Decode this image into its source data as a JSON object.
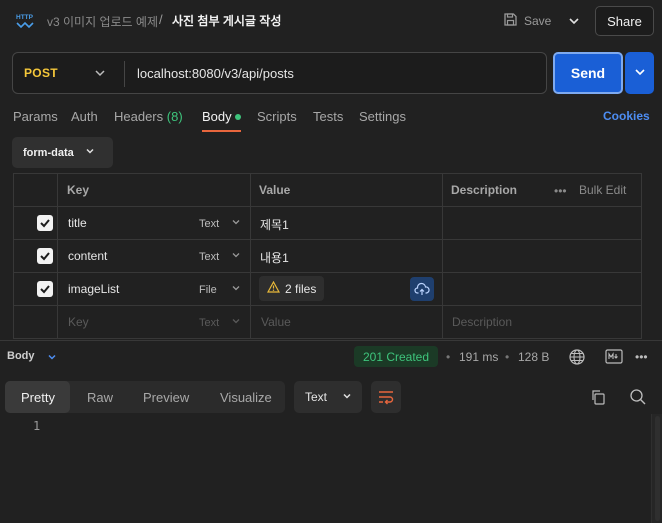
{
  "header": {
    "collection": "v3 이미지 업로드 예제",
    "separator": "/",
    "request_name": "사진 첨부 게시글 작성",
    "save_label": "Save",
    "share_label": "Share",
    "app_icon": "http-icon"
  },
  "request": {
    "method": "POST",
    "url": "localhost:8080/v3/api/posts",
    "send_label": "Send",
    "method_color": "#f5c73a",
    "send_color": "#1a5fd6"
  },
  "tabs": {
    "params": "Params",
    "auth": "Auth",
    "headers": "Headers",
    "headers_count": "(8)",
    "body": "Body",
    "scripts": "Scripts",
    "tests": "Tests",
    "settings": "Settings",
    "cookies": "Cookies",
    "active": "Body"
  },
  "body": {
    "mode": "form-data",
    "columns": {
      "key": "Key",
      "value": "Value",
      "description": "Description",
      "bulk_edit": "Bulk Edit"
    },
    "rows": [
      {
        "checked": true,
        "key": "title",
        "type": "Text",
        "value": "제목1",
        "description": ""
      },
      {
        "checked": true,
        "key": "content",
        "type": "Text",
        "value": "내용1",
        "description": ""
      },
      {
        "checked": true,
        "key": "imageList",
        "type": "File",
        "value": "2 files",
        "description": ""
      }
    ],
    "placeholder_row": {
      "key": "Key",
      "type": "Text",
      "value": "Value",
      "description": "Description"
    }
  },
  "response": {
    "label": "Body",
    "status": "201 Created",
    "time": "191 ms",
    "size": "128 B",
    "status_color": "#3ec47c",
    "view_tabs": [
      "Pretty",
      "Raw",
      "Preview",
      "Visualize"
    ],
    "active_view": "Pretty",
    "format": "Text",
    "lines": [
      "1"
    ]
  }
}
